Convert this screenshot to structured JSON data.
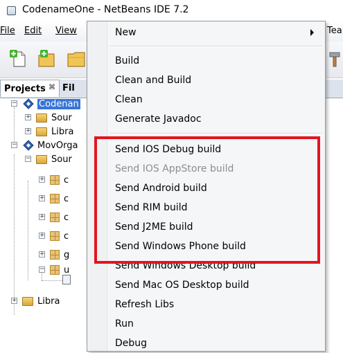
{
  "window": {
    "title": "CodenameOne - NetBeans IDE 7.2"
  },
  "menubar": {
    "items": [
      {
        "label": "File",
        "mnemonic": "F"
      },
      {
        "label": "Edit",
        "mnemonic": "E"
      },
      {
        "label": "View",
        "mnemonic": "V"
      }
    ],
    "right_partial": "Tea"
  },
  "toolbar": {
    "buttons": [
      {
        "icon": "new-file-icon"
      },
      {
        "icon": "new-project-icon"
      },
      {
        "icon": "open-project-icon"
      }
    ],
    "right_icon": "build-hammer-icon"
  },
  "panel": {
    "active_tab": "Projects",
    "close_glyph": "⌘",
    "other_tab": "Fil"
  },
  "tree": {
    "nodes": [
      {
        "label": "Codenan",
        "icon": "project-icon",
        "expanded": true,
        "selected": true
      },
      {
        "label": "Sour",
        "icon": "folder-icon",
        "expanded": false
      },
      {
        "label": "Libra",
        "icon": "folder-icon",
        "expanded": false
      },
      {
        "label": "MovOrga",
        "icon": "project-icon",
        "expanded": true
      },
      {
        "label": "Sour",
        "icon": "folder-icon",
        "expanded": true
      },
      {
        "label": "",
        "icon": "package-icon"
      },
      {
        "label": "",
        "icon": "package-icon"
      },
      {
        "label": "",
        "icon": "package-icon"
      },
      {
        "label": "",
        "icon": "package-icon"
      },
      {
        "label": "",
        "icon": "package-icon"
      },
      {
        "label": "",
        "icon": "package-icon"
      },
      {
        "label": "",
        "icon": "file-icon"
      },
      {
        "label": "Libra",
        "icon": "folder-icon",
        "expanded": false
      }
    ],
    "pkg_partials": [
      "c",
      "c",
      "c",
      "c",
      "g",
      "u"
    ]
  },
  "context_menu": {
    "items": [
      {
        "label": "New",
        "submenu": true,
        "enabled": true
      },
      {
        "separator": true
      },
      {
        "label": "Build",
        "enabled": true
      },
      {
        "label": "Clean and Build",
        "enabled": true
      },
      {
        "label": "Clean",
        "enabled": true
      },
      {
        "label": "Generate Javadoc",
        "enabled": true
      },
      {
        "separator": true
      },
      {
        "label": "Send IOS Debug build",
        "enabled": true
      },
      {
        "label": "Send IOS AppStore build",
        "enabled": false
      },
      {
        "label": "Send Android build",
        "enabled": true
      },
      {
        "label": "Send RIM build",
        "enabled": true
      },
      {
        "label": "Send J2ME build",
        "enabled": true
      },
      {
        "label": "Send Windows Phone build",
        "enabled": true
      },
      {
        "label": "Send Windows Desktop build",
        "enabled": true
      },
      {
        "label": "Send Mac OS Desktop build",
        "enabled": true
      },
      {
        "label": "Refresh Libs",
        "enabled": true
      },
      {
        "label": "Run",
        "enabled": true
      },
      {
        "label": "Debug",
        "enabled": true
      }
    ]
  },
  "colors": {
    "highlight_border": "#e4141f",
    "selection": "#3875d7",
    "disabled_text": "#8d8d8d"
  }
}
